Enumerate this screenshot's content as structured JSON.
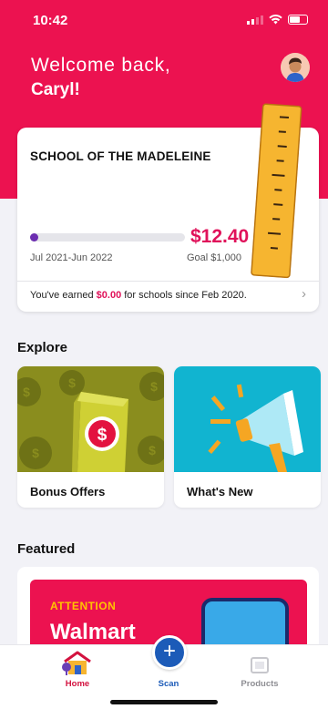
{
  "status_bar": {
    "time": "10:42"
  },
  "header": {
    "greeting": "Welcome back,",
    "user_name": "Caryl!"
  },
  "school_card": {
    "school_name": "SCHOOL OF THE MADELEINE",
    "progress_fraction": 0.012,
    "period": "Jul 2021-Jun 2022",
    "amount": "$12.40",
    "goal": "Goal $1,000",
    "earned_prefix": "You've earned ",
    "earned_amount": "$0.00",
    "earned_suffix": " for schools since Feb 2020."
  },
  "explore": {
    "title": "Explore",
    "tiles": [
      {
        "label": "Bonus Offers",
        "icon": "bonus-bag-illustration"
      },
      {
        "label": "What's New",
        "icon": "megaphone-illustration"
      }
    ]
  },
  "featured": {
    "title": "Featured",
    "banner_attention": "ATTENTION",
    "banner_brand": "Walmart"
  },
  "tabbar": {
    "home": "Home",
    "scan": "Scan",
    "products": "Products",
    "scan_symbol": "+"
  },
  "colors": {
    "brand_red": "#ec1250",
    "amount_pink": "#e0125a",
    "progress_purple": "#6b2db0",
    "scan_blue": "#1c5bb8",
    "home_active": "#d3123f",
    "products_inactive": "#8e8e93"
  }
}
